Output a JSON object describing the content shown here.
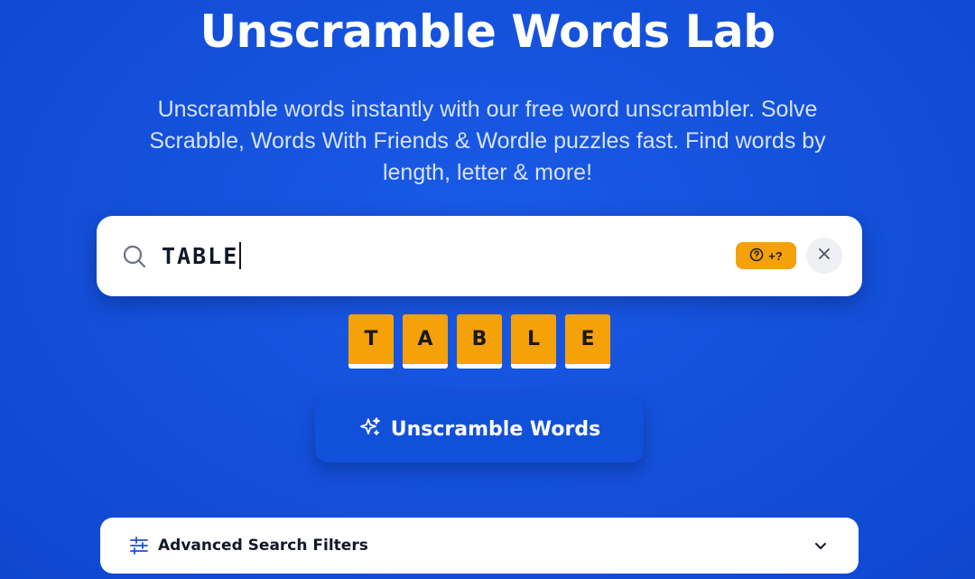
{
  "header": {
    "title": "Unscramble Words Lab",
    "subtitle": "Unscramble words instantly with our free word unscrambler. Solve Scrabble, Words With Friends & Wordle puzzles fast. Find words by length, letter & more!"
  },
  "search": {
    "value": "TABLE",
    "wildcard_label": "+?",
    "icons": {
      "search": "search-icon",
      "wildcard": "question-circle-icon",
      "clear": "close-icon"
    }
  },
  "tiles": [
    "T",
    "A",
    "B",
    "L",
    "E"
  ],
  "action": {
    "label": "Unscramble Words",
    "icon": "sparkles-icon"
  },
  "filters": {
    "label": "Advanced Search Filters",
    "icon": "sliders-icon",
    "toggle_icon": "chevron-down-icon"
  },
  "colors": {
    "background": "#1552dc",
    "accent_tile": "#f5a10a",
    "button": "#1150d8"
  }
}
